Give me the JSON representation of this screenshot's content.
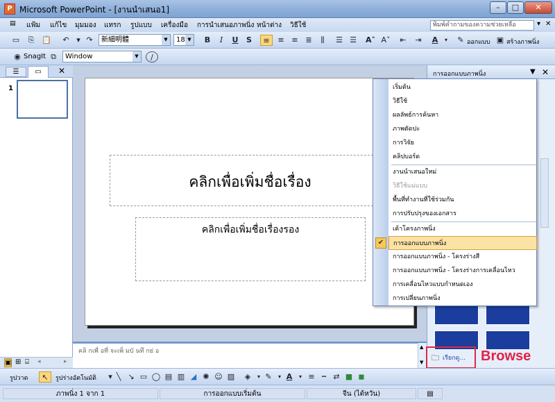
{
  "window": {
    "title": "Microsoft PowerPoint - [งานนำเสนอ1]",
    "app_icon": "P"
  },
  "menu": {
    "items": [
      "แฟ้ม",
      "แก้ไข",
      "มุมมอง",
      "แทรก",
      "รูปแบบ",
      "เครื่องมือ",
      "การนำเสนอภาพนิ่ง",
      "หน้าต่าง",
      "วิธีใช้"
    ],
    "help_placeholder": "พิมพ์คำถามของความช่วยเหลือ"
  },
  "format_toolbar": {
    "font": "新細明體",
    "size": "18",
    "bold": "B",
    "italic": "I",
    "underline": "U",
    "shadow": "S",
    "design_label": "ออกแบบ",
    "new_slide_label": "สร้างภาพนิ่ง"
  },
  "snagit": {
    "label": "SnagIt",
    "window_combo": "Window"
  },
  "slide": {
    "title_placeholder": "คลิกเพื่อเพิ่มชื่อเรื่อง",
    "subtitle_placeholder": "คลิกเพื่อเพิ่มชื่อเรื่องรอง",
    "thumb_number": "1"
  },
  "notes": {
    "placeholder": "คลิ กเพื่ อที่ จะเพิ่ มบั นทึ กย่ อ"
  },
  "taskpane": {
    "header": "การออกแบบภาพนิ่ง",
    "menu_items": [
      {
        "label": "เริ่มต้น",
        "enabled": true
      },
      {
        "label": "วิธีใช้",
        "enabled": true
      },
      {
        "label": "ผลลัพธ์การค้นหา",
        "enabled": true
      },
      {
        "label": "ภาพตัดปะ",
        "enabled": true
      },
      {
        "label": "การวิจัย",
        "enabled": true
      },
      {
        "label": "คลิปบอร์ด",
        "enabled": true
      },
      {
        "label": "งานนำเสนอใหม่",
        "enabled": true
      },
      {
        "label": "วิธีใช้แม่แบบ",
        "enabled": false
      },
      {
        "label": "พื้นที่ทำงานที่ใช้ร่วมกัน",
        "enabled": true
      },
      {
        "label": "การปรับปรุงของเอกสาร",
        "enabled": true
      },
      {
        "label": "เค้าโครงภาพนิ่ง",
        "enabled": true
      },
      {
        "label": "การออกแบบภาพนิ่ง",
        "enabled": true,
        "selected": true
      },
      {
        "label": "การออกแบบภาพนิ่ง - โครงร่างสี",
        "enabled": true
      },
      {
        "label": "การออกแบบภาพนิ่ง - โครงร่างการเคลื่อนไหว",
        "enabled": true
      },
      {
        "label": "การเคลื่อนไหวแบบกำหนดเอง",
        "enabled": true
      },
      {
        "label": "การเปลี่ยนภาพนิ่ง",
        "enabled": true
      }
    ],
    "browse_link": "เรียกดู..."
  },
  "annotation": {
    "browse_label": "Browse",
    "color": "#e3214a"
  },
  "drawbar": {
    "draw_label": "รูปวาด",
    "autoshapes_label": "รูปร่างอัตโนมัติ"
  },
  "status": {
    "slide": "ภาพนิ่ง 1 จาก 1",
    "design": "การออกแบบเริ่มต้น",
    "language": "จีน (ไต้หวัน)"
  }
}
